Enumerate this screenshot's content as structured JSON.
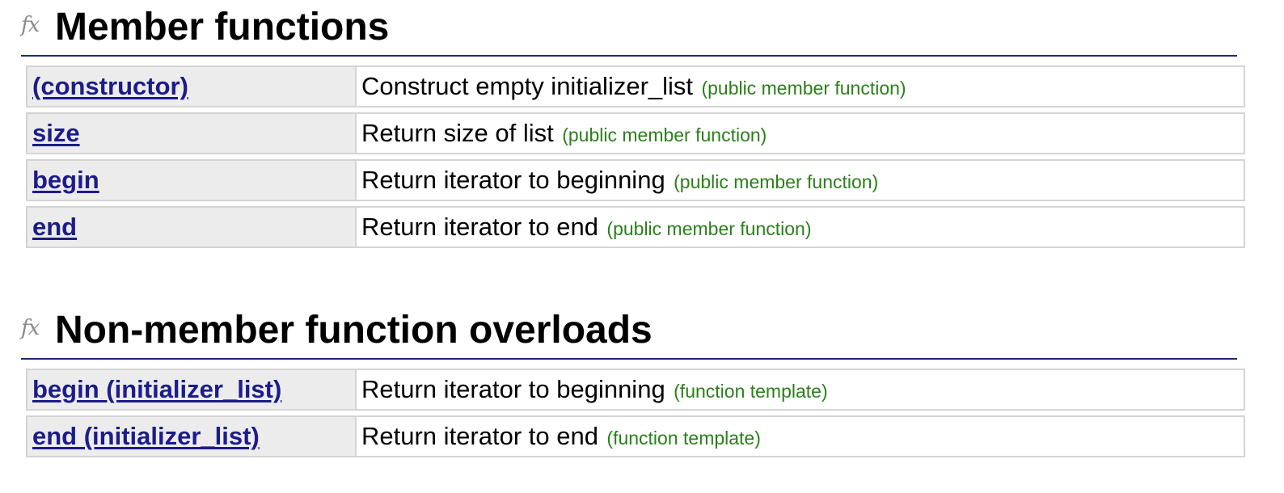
{
  "sections": [
    {
      "icon": "fx-icon",
      "icon_text": "fx",
      "title": "Member functions",
      "rows": [
        {
          "name": "(constructor)",
          "description": "Construct empty initializer_list",
          "kind": "(public member function)"
        },
        {
          "name": "size",
          "description": "Return size of list",
          "kind": "(public member function)"
        },
        {
          "name": "begin",
          "description": "Return iterator to beginning",
          "kind": "(public member function)"
        },
        {
          "name": "end",
          "description": "Return iterator to end",
          "kind": "(public member function)"
        }
      ]
    },
    {
      "icon": "fx-icon",
      "icon_text": "fx",
      "title": "Non-member function overloads",
      "rows": [
        {
          "name": "begin (initializer_list)",
          "description": "Return iterator to beginning",
          "kind": "(function template)"
        },
        {
          "name": "end (initializer_list)",
          "description": "Return iterator to end",
          "kind": "(function template)"
        }
      ]
    }
  ],
  "colors": {
    "link": "#1c1c8a",
    "kind": "#2a7f1a",
    "rule": "#1f2a7a",
    "name_cell_bg": "#ececec",
    "border": "#d4d4d4"
  }
}
